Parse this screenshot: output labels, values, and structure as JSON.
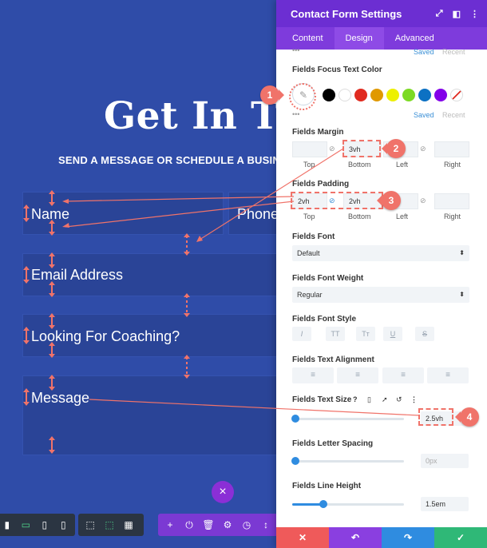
{
  "canvas": {
    "title": "Get In Tou",
    "subtitle": "SEND A MESSAGE OR SCHEDULE A BUSIN",
    "fields": {
      "name": "Name",
      "phone": "Phone",
      "email": "Email Address",
      "coaching": "Looking For Coaching?",
      "message": "Message"
    },
    "close_glyph": "×"
  },
  "panel": {
    "title": "Contact Form Settings",
    "tabs": [
      "Content",
      "Design",
      "Advanced"
    ],
    "active_tab": "Design",
    "top_saved": "Saved",
    "top_recent": "Recent",
    "focus_text_color": {
      "label": "Fields Focus Text Color",
      "swatches": [
        "#000000",
        "#ffffff",
        "#e02b20",
        "#e09900",
        "#edf000",
        "#7cda24",
        "#0c71c3",
        "#8300e9"
      ],
      "saved": "Saved",
      "recent": "Recent"
    },
    "margin": {
      "label": "Fields Margin",
      "top": "",
      "bottom": "3vh",
      "left": "",
      "right": "",
      "sub": [
        "Top",
        "Bottom",
        "Left",
        "Right"
      ]
    },
    "padding": {
      "label": "Fields Padding",
      "top": "2vh",
      "bottom": "2vh",
      "left": "",
      "right": "",
      "sub": [
        "Top",
        "Bottom",
        "Left",
        "Right"
      ]
    },
    "font": {
      "label": "Fields Font",
      "value": "Default"
    },
    "font_weight": {
      "label": "Fields Font Weight",
      "value": "Regular"
    },
    "font_style": {
      "label": "Fields Font Style",
      "buttons": [
        "I",
        "TT",
        "Tт",
        "U",
        "S"
      ]
    },
    "text_alignment": {
      "label": "Fields Text Alignment",
      "buttons": [
        "≡",
        "≡",
        "≡",
        "≡"
      ]
    },
    "text_size": {
      "label": "Fields Text Size",
      "help": "?",
      "value": "2.5vh",
      "level": 0.03
    },
    "letter_spacing": {
      "label": "Fields Letter Spacing",
      "value": "0px",
      "level": 0.03
    },
    "line_height": {
      "label": "Fields Line Height",
      "value": "1.5em",
      "level": 0.28
    },
    "footer": {
      "cancel": "✕",
      "undo": "↶",
      "redo": "↷",
      "save": "✓"
    }
  },
  "annotations": [
    "1",
    "2",
    "3",
    "4"
  ],
  "colors": {
    "canvas_bg": "#2f4ca8",
    "panel_header": "#6c2ed2",
    "accent": "#f0736a",
    "blue": "#2f8ce0",
    "cancel": "#ef5a5a",
    "undo": "#8a3fe0",
    "redo": "#2f8ce0",
    "save": "#2fb877"
  }
}
